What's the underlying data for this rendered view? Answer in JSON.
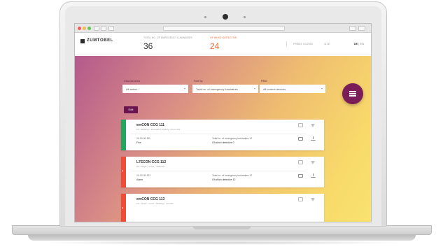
{
  "header": {
    "logo": "ZUMTOBEL",
    "stat1_label": "TOTAL NO. OF EMERGENCY LUMINAIRES",
    "stat1_value": "36",
    "stat2_label": "OF WHICH DEFECTIVE",
    "stat2_value": "24",
    "meta1": "FRIDAY, 0/1/2018",
    "meta2": "11:30",
    "lang_de": "DE",
    "lang_sep": "|",
    "lang_en": "EN"
  },
  "filters": {
    "area_label": "Choose area",
    "area_value": "All areas...",
    "sort_label": "Sort by",
    "sort_value": "Total no. of emergency luminaires",
    "filter_label": "Filter",
    "filter_value": "All control devices"
  },
  "edit_button": "Edit",
  "cards": [
    {
      "title": "emCON CCG 111",
      "sub": "All > Building > Emergency lighting > Floor 001",
      "ip": "10.10.40.111",
      "status": "Fine",
      "em": "Total no. of emergency luminaires 12",
      "def": "Of which defective 0",
      "stripe": "#1fa760"
    },
    {
      "title": "L7ECON CCG 112",
      "sub": "All > Aleph > Level > Staircase",
      "ip": "10.10.40.112",
      "status": "Alarm",
      "em": "Total no. of emergency luminaires 12",
      "def": "Of which defective 12",
      "stripe": "#ef4b36"
    },
    {
      "title": "emCON CCG 113",
      "sub": "All > Aleph > Level > Building > Corridor",
      "ip": "",
      "status": "",
      "em": "",
      "def": "",
      "stripe": "#ef4b36"
    }
  ],
  "colors": {
    "accent": "#7b1d58",
    "alert": "#f26b38",
    "ok": "#1fa760",
    "error": "#ef4b36"
  }
}
